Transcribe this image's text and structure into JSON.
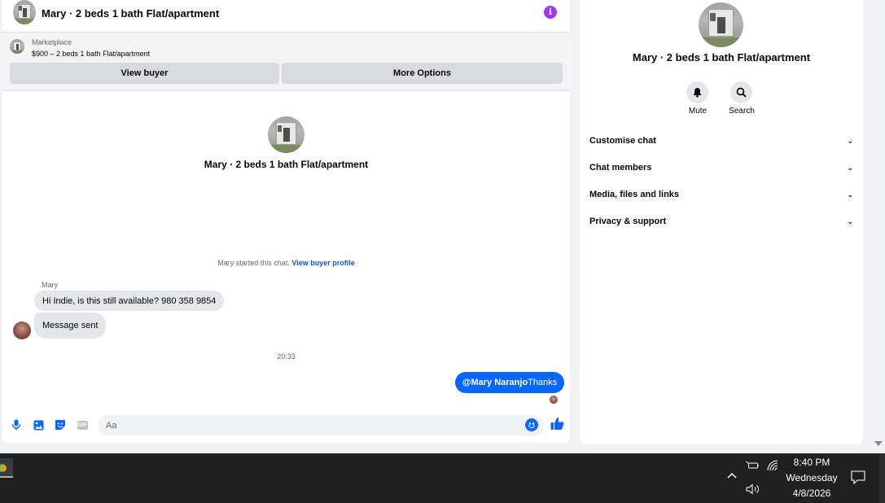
{
  "chat": {
    "title": "Mary · 2 beds 1 bath Flat/apartment",
    "marketplace": {
      "label": "Marketplace",
      "listing": "$900 – 2 beds 1 bath Flat/apartment"
    },
    "buttons": {
      "view_buyer": "View buyer",
      "more_options": "More Options"
    },
    "center_title": "Mary · 2 beds 1 bath Flat/apartment",
    "started_text": "Mary started this chat.",
    "started_link": "View buyer profile",
    "sender_name": "Mary",
    "messages_in": [
      "Hi Indie, is this still available? 980 358 9854",
      "Message sent"
    ],
    "timestamp": "20:33",
    "message_out": {
      "mention": "@Mary Naranjo",
      "text": "Thanks"
    },
    "composer": {
      "placeholder": "Aa",
      "gif_label": "GIF"
    }
  },
  "details": {
    "title": "Mary · 2 beds 1 bath Flat/apartment",
    "actions": [
      {
        "label": "Mute",
        "icon": "bell-icon"
      },
      {
        "label": "Search",
        "icon": "search-icon"
      }
    ],
    "menu": [
      "Customise chat",
      "Chat members",
      "Media, files and links",
      "Privacy & support"
    ],
    "chevron": "⌄"
  },
  "taskbar": {
    "time": "8:40 PM",
    "day": "Wednesday",
    "date": "4/8/2026"
  },
  "colors": {
    "accent": "#0866ff",
    "info": "#a033ff",
    "taskbar": "#202020"
  }
}
